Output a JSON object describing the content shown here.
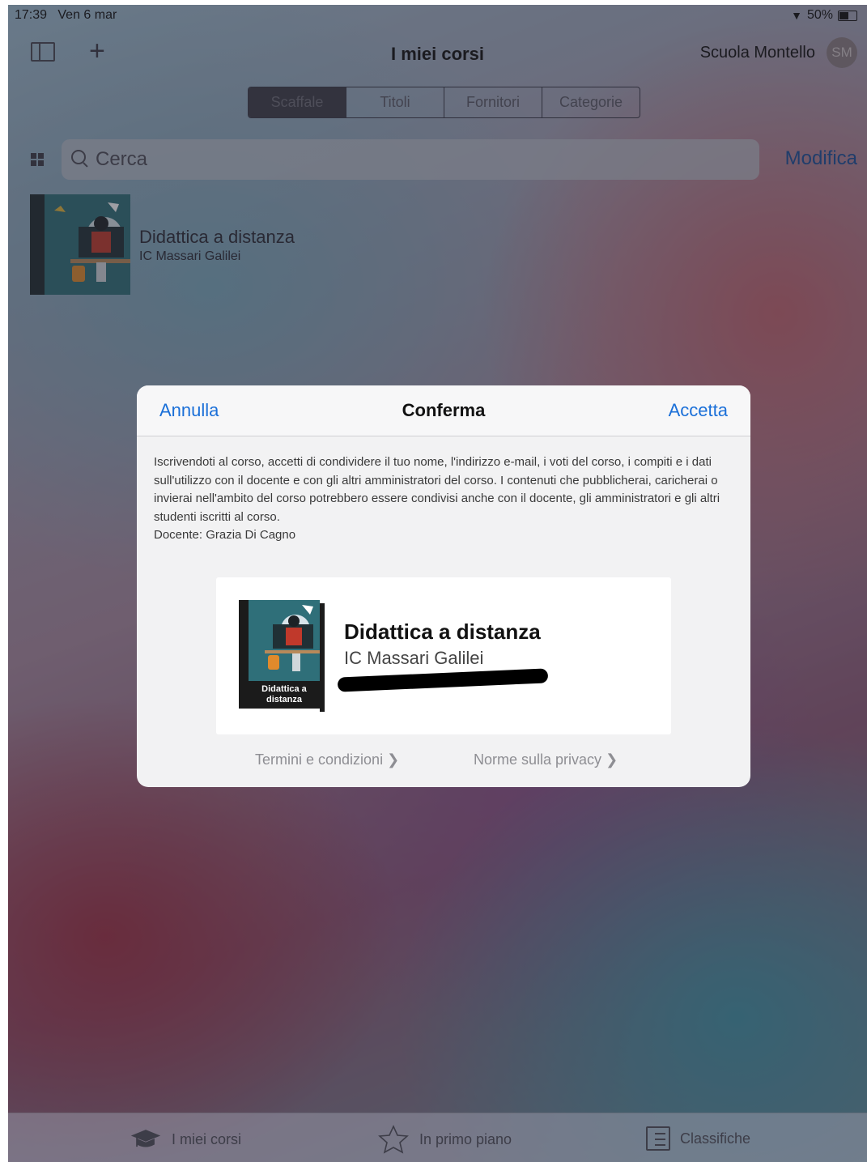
{
  "status": {
    "time": "17:39",
    "date": "Ven 6 mar",
    "battery": "50%"
  },
  "nav": {
    "title": "I miei corsi",
    "school": "Scuola Montello",
    "avatar_initials": "SM"
  },
  "segments": [
    "Scaffale",
    "Titoli",
    "Fornitori",
    "Categorie"
  ],
  "search": {
    "placeholder": "Cerca",
    "edit_label": "Modifica"
  },
  "course": {
    "title": "Didattica a distanza",
    "school": "IC Massari Galilei"
  },
  "modal": {
    "cancel": "Annulla",
    "title": "Conferma",
    "accept": "Accetta",
    "body": "Iscrivendoti al corso, accetti di condividere il tuo nome, l'indirizzo e-mail, i voti del corso, i compiti e i dati sull'utilizzo con il docente e con gli altri amministratori del corso. I contenuti che pubblicherai, caricherai o invierai nell'ambito del corso potrebbero essere condivisi anche con il docente, gli amministratori e gli altri studenti iscritti al corso.",
    "teacher": "Docente: Grazia Di Cagno",
    "card_title": "Didattica a distanza",
    "card_school": "IC Massari Galilei",
    "book_label": "Didattica a distanza",
    "terms": "Termini e condizioni",
    "privacy": "Norme sulla privacy"
  },
  "tabs": [
    {
      "label": "I miei corsi",
      "icon": "graduation-cap-icon"
    },
    {
      "label": "In primo piano",
      "icon": "star-icon"
    },
    {
      "label": "Classifiche",
      "icon": "list-icon"
    }
  ],
  "colors": {
    "accent": "#1a6fd8",
    "modal_bg": "#f2f2f3"
  }
}
